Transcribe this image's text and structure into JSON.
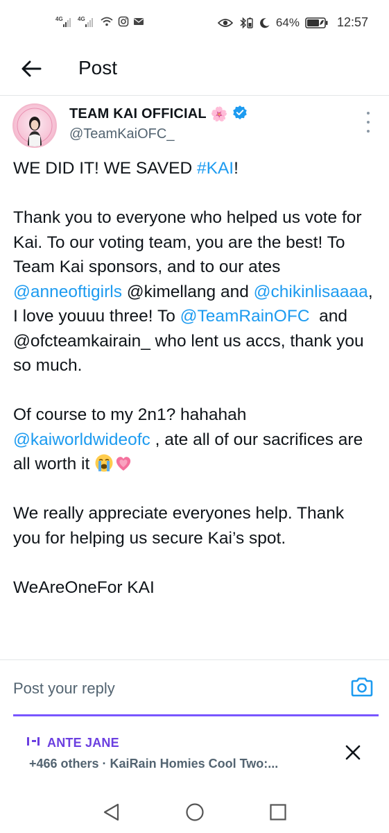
{
  "status_bar": {
    "signal1": "4G",
    "signal2": "4G",
    "battery_percent": "64%",
    "time": "12:57",
    "icons": [
      "signal-icon",
      "signal-icon",
      "wifi-icon",
      "instagram-icon",
      "mail-icon",
      "eye-icon",
      "bluetooth-battery-icon",
      "moon-icon",
      "battery-icon"
    ]
  },
  "header": {
    "title": "Post",
    "back_icon": "arrow-left-icon"
  },
  "post": {
    "author_name": "TEAM KAI OFFICIAL",
    "author_emoji": "🌸",
    "verified": true,
    "handle": "@TeamKaiOFC_",
    "body": {
      "line1_prefix": "WE DID IT! WE SAVED ",
      "line1_hashtag": "#KAI",
      "line1_suffix": "!",
      "p2_a": "Thank you to everyone who helped us vote for Kai. To our voting team, you are the best! To Team Kai sponsors, and to our ates ",
      "mention1": "@anneoftigirls",
      "p2_b": " @kimellang and ",
      "mention2": "@chikinlisaaaa",
      "p2_c": ", I love youuu three! To ",
      "mention3": "@TeamRainOFC",
      "p2_d": "  and @ofcteamkairain_ who lent us accs, thank you so much.",
      "p3_a": "Of course to my 2n1? hahahah ",
      "mention4": "@kaiworldwideofc",
      "p3_b": " , ate all of our sacrifices are all worth it ",
      "p4": "We really appreciate everyones help. Thank you for helping us secure Kai’s spot.",
      "p5": "WeAreOneFor KAI"
    }
  },
  "reply": {
    "placeholder": "Post your reply"
  },
  "space": {
    "host": "ANTE JANE",
    "subtitle": "+466 others · KaiRain Homies Cool Two:..."
  },
  "colors": {
    "link": "#1d9bf0",
    "space_accent": "#6b3fe0",
    "underline": "#7856ff",
    "text": "#0f1419",
    "secondary": "#536471"
  }
}
